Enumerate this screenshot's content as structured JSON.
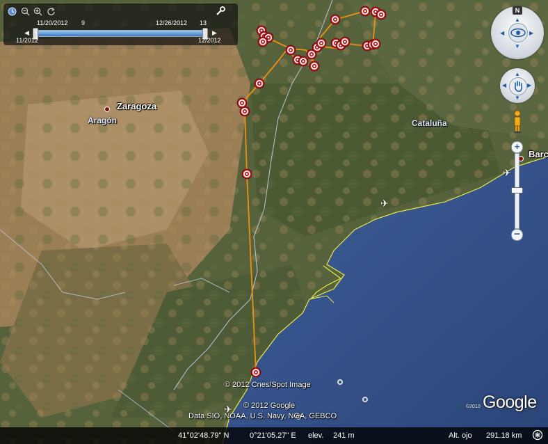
{
  "map": {
    "places": {
      "zaragoza": "Zaragoza",
      "aragon": "Aragón",
      "cataluna": "Cataluña",
      "barcelona": "Barc"
    },
    "track_color": "#f09010",
    "marker_color": "#c0161b",
    "coast_line_color": "#e8e84a"
  },
  "time_slider": {
    "range_start": "11/20/2012",
    "range_start_count": "9",
    "range_end": "12/26/2012",
    "range_end_count": "13",
    "min_label": "11/2012",
    "max_label": "12/2012",
    "icons": [
      "clock-icon",
      "zoom-out-time-icon",
      "zoom-in-time-icon",
      "refresh-icon",
      "wrench-icon"
    ]
  },
  "navigation": {
    "north": "N"
  },
  "attribution": {
    "line1": "© 2012 Cnes/Spot Image",
    "line2": "© 2012 Google",
    "line3": "Data SIO, NOAA, U.S. Navy, NGA, GEBCO",
    "logo": "Google",
    "logo_year": "©2010"
  },
  "status": {
    "latitude": "41°02'48.79\" N",
    "longitude": "0°21'05.27\" E",
    "elevation_label": "elev.",
    "elevation": "241 m",
    "eye_alt_label": "Alt. ojo",
    "eye_alt": "291.18 km"
  }
}
